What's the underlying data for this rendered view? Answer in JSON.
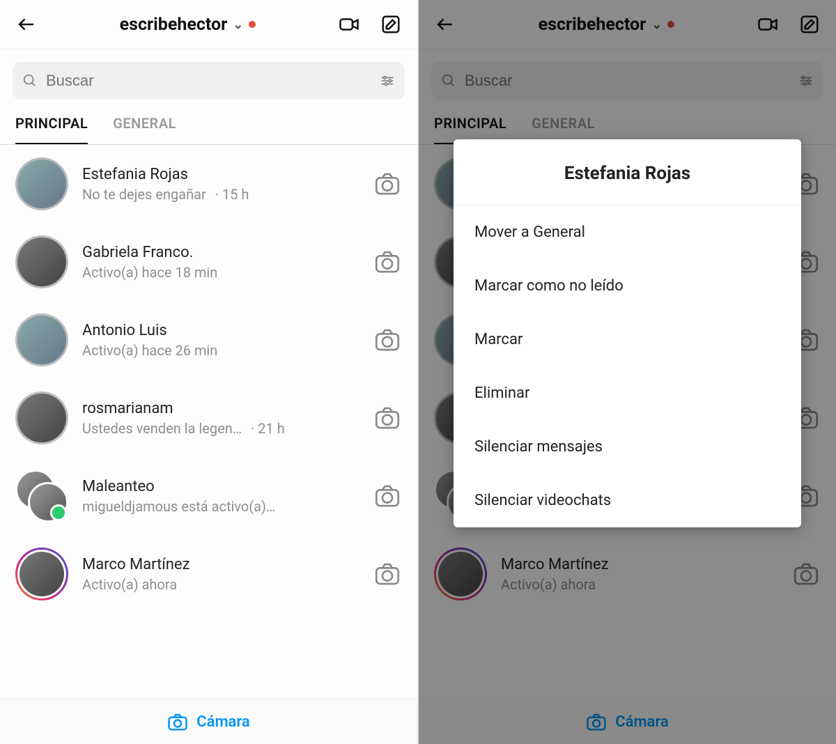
{
  "header": {
    "username": "escribehector"
  },
  "search": {
    "placeholder": "Buscar"
  },
  "tabs": {
    "principal": "PRINCIPAL",
    "general": "GENERAL"
  },
  "chats": [
    {
      "name": "Estefania Rojas",
      "sub": "No te dejes engañar",
      "time": "15 h",
      "story": false,
      "group": false,
      "online": false
    },
    {
      "name": "Gabriela Franco.",
      "sub": "Activo(a) hace 18 min",
      "time": "",
      "story": false,
      "group": false,
      "online": false
    },
    {
      "name": "Antonio Luis",
      "sub": "Activo(a) hace 26 min",
      "time": "",
      "story": false,
      "group": false,
      "online": false
    },
    {
      "name": "rosmarianam",
      "sub": "Ustedes venden la legen…",
      "time": "21 h",
      "story": false,
      "group": false,
      "online": false
    },
    {
      "name": "Maleanteo",
      "sub": "migueldjamous está activo(a)…",
      "time": "",
      "story": false,
      "group": true,
      "online": true
    },
    {
      "name": "Marco Martínez",
      "sub": "Activo(a) ahora",
      "time": "",
      "story": true,
      "group": false,
      "online": false
    }
  ],
  "camera_label": "Cámara",
  "popup": {
    "title": "Estefania Rojas",
    "items": [
      "Mover a General",
      "Marcar como no leído",
      "Marcar",
      "Eliminar",
      "Silenciar mensajes",
      "Silenciar videochats"
    ]
  }
}
